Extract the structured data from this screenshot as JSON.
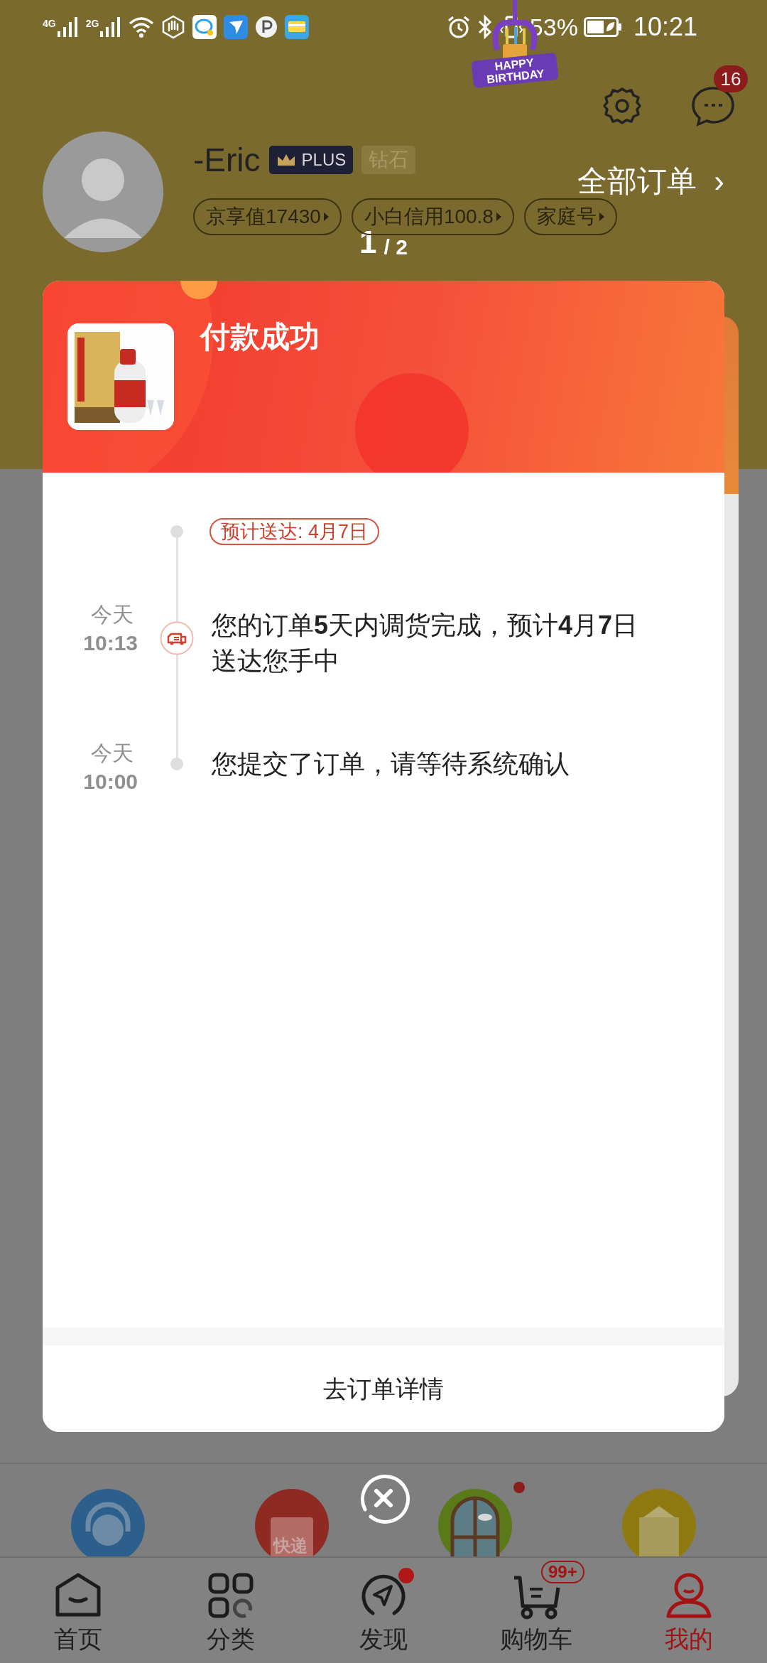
{
  "status_bar": {
    "network_1": "4G",
    "network_2": "2G",
    "battery": "53%",
    "time": "10:21"
  },
  "header": {
    "birthday_badge": "HAPPY BIRTHDAY",
    "message_count": "16",
    "user_name": "-Eric",
    "plus_badge": "PLUS",
    "level_badge": "钻石",
    "chips": [
      "京享值17430",
      "小白信用100.8",
      "家庭号"
    ],
    "all_orders": "全部订单",
    "all_orders_arrow": "›"
  },
  "pager": {
    "current": "1",
    "rest": "/ 2"
  },
  "modal": {
    "title": "付款成功",
    "eta_tag": "预计送达: 4月7日",
    "timeline": [
      {
        "kind": "truck",
        "day": "今天",
        "time": "10:13",
        "text": "您的订单**5**天内调货完成，预计**4**月**7**日送达您手中"
      },
      {
        "kind": "dot",
        "day": "今天",
        "time": "10:00",
        "text": "您提交了订单，请等待系统确认"
      }
    ],
    "action": "去订单详情"
  },
  "tools_section": {
    "items": [
      {
        "kind": "headset",
        "dot": false
      },
      {
        "kind": "parcel",
        "label": "快递",
        "dot": false
      },
      {
        "kind": "window",
        "dot": true
      },
      {
        "kind": "gift",
        "dot": false
      }
    ]
  },
  "bottom_nav": [
    {
      "kind": "home",
      "label": "首页",
      "selected": false,
      "dot": false
    },
    {
      "kind": "grid",
      "label": "分类",
      "selected": false,
      "dot": false
    },
    {
      "kind": "compass",
      "label": "发现",
      "selected": false,
      "dot": true
    },
    {
      "kind": "cart",
      "label": "购物车",
      "selected": false,
      "dot": false,
      "badge": "99+"
    },
    {
      "kind": "person",
      "label": "我的",
      "selected": true,
      "dot": false
    }
  ]
}
